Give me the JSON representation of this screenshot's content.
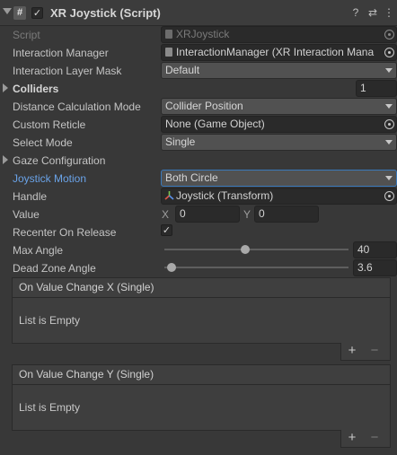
{
  "header": {
    "title": "XR Joystick (Script)",
    "script_icon": "#",
    "enabled": "✓",
    "help_icon": "?",
    "preset_icon": "⇄",
    "menu_icon": "⋮"
  },
  "rows": {
    "script": {
      "label": "Script",
      "value": "XRJoystick"
    },
    "interaction_manager": {
      "label": "Interaction Manager",
      "value": "InteractionManager (XR Interaction Mana"
    },
    "interaction_layer_mask": {
      "label": "Interaction Layer Mask",
      "value": "Default"
    },
    "colliders": {
      "label": "Colliders",
      "value": "1"
    },
    "distance_calc": {
      "label": "Distance Calculation Mode",
      "value": "Collider Position"
    },
    "custom_reticle": {
      "label": "Custom Reticle",
      "value": "None (Game Object)"
    },
    "select_mode": {
      "label": "Select Mode",
      "value": "Single"
    },
    "gaze_config": {
      "label": "Gaze Configuration"
    },
    "joystick_motion": {
      "label": "Joystick Motion",
      "value": "Both Circle"
    },
    "handle": {
      "label": "Handle",
      "value": "Joystick (Transform)"
    },
    "value": {
      "label": "Value",
      "x_label": "X",
      "x": "0",
      "y_label": "Y",
      "y": "0"
    },
    "recenter": {
      "label": "Recenter On Release",
      "checked": "✓"
    },
    "max_angle": {
      "label": "Max Angle",
      "value": "40",
      "fraction": 0.44
    },
    "dead_zone": {
      "label": "Dead Zone Angle",
      "value": "3.6",
      "fraction": 0.04
    }
  },
  "events": [
    {
      "title": "On Value Change X (Single)",
      "empty": "List is Empty",
      "plus": "+",
      "minus": "−"
    },
    {
      "title": "On Value Change Y (Single)",
      "empty": "List is Empty",
      "plus": "+",
      "minus": "−"
    }
  ],
  "colors": {
    "background": "#383838",
    "accent_blue": "#6aa3e8",
    "focus_border": "#3a79bb"
  }
}
